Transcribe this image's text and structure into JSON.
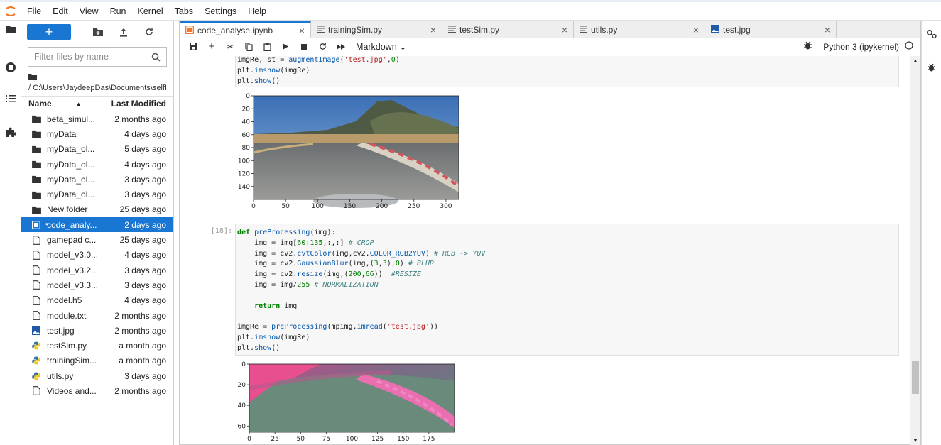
{
  "menu": [
    "File",
    "Edit",
    "View",
    "Run",
    "Kernel",
    "Tabs",
    "Settings",
    "Help"
  ],
  "filebrowser": {
    "filter_placeholder": "Filter files by name",
    "path": "/ C:\\Users\\JaydeepDas\\Documents\\selfI",
    "col_name": "Name",
    "col_modified": "Last Modified",
    "files": [
      {
        "name": "beta_simul...",
        "modified": "2 months ago",
        "type": "folder"
      },
      {
        "name": "myData",
        "modified": "4 days ago",
        "type": "folder"
      },
      {
        "name": "myData_ol...",
        "modified": "5 days ago",
        "type": "folder"
      },
      {
        "name": "myData_ol...",
        "modified": "4 days ago",
        "type": "folder"
      },
      {
        "name": "myData_ol...",
        "modified": "3 days ago",
        "type": "folder"
      },
      {
        "name": "myData_ol...",
        "modified": "3 days ago",
        "type": "folder"
      },
      {
        "name": "New folder",
        "modified": "25 days ago",
        "type": "folder"
      },
      {
        "name": "code_analy...",
        "modified": "2 days ago",
        "type": "notebook",
        "selected": true
      },
      {
        "name": "gamepad c...",
        "modified": "25 days ago",
        "type": "file"
      },
      {
        "name": "model_v3.0...",
        "modified": "4 days ago",
        "type": "file"
      },
      {
        "name": "model_v3.2...",
        "modified": "3 days ago",
        "type": "file"
      },
      {
        "name": "model_v3.3...",
        "modified": "3 days ago",
        "type": "file"
      },
      {
        "name": "model.h5",
        "modified": "4 days ago",
        "type": "file"
      },
      {
        "name": "module.txt",
        "modified": "2 months ago",
        "type": "file"
      },
      {
        "name": "test.jpg",
        "modified": "2 months ago",
        "type": "image"
      },
      {
        "name": "testSim.py",
        "modified": "a month ago",
        "type": "python"
      },
      {
        "name": "trainingSim...",
        "modified": "a month ago",
        "type": "python"
      },
      {
        "name": "utils.py",
        "modified": "3 days ago",
        "type": "python"
      },
      {
        "name": "Videos and...",
        "modified": "2 months ago",
        "type": "file"
      }
    ]
  },
  "tabs": [
    {
      "label": "code_analyse.ipynb",
      "icon": "notebook-icon",
      "active": true
    },
    {
      "label": "trainingSim.py",
      "icon": "text-file-icon"
    },
    {
      "label": "testSim.py",
      "icon": "text-file-icon"
    },
    {
      "label": "utils.py",
      "icon": "text-file-icon"
    },
    {
      "label": "test.jpg",
      "icon": "image-icon"
    }
  ],
  "toolbar": {
    "cell_type": "Markdown",
    "kernel": "Python 3 (ipykernel)"
  },
  "cell1": {
    "lines": [
      "imgRe, st = augmentImage('test.jpg',0)",
      "plt.imshow(imgRe)",
      "plt.show()"
    ]
  },
  "plot1": {
    "x_ticks": [
      "0",
      "50",
      "100",
      "150",
      "200",
      "250",
      "300"
    ],
    "y_ticks": [
      "0",
      "20",
      "40",
      "60",
      "80",
      "100",
      "120",
      "140"
    ]
  },
  "cell2": {
    "prompt": "[18]:",
    "lines": [
      "def preProcessing(img):",
      "    img = img[60:135,:,:] # CROP",
      "    img = cv2.cvtColor(img,cv2.COLOR_RGB2YUV) # RGB -> YUV",
      "    img = cv2.GaussianBlur(img,(3,3),0) # BLUR",
      "    img = cv2.resize(img,(200,66))  #RESIZE",
      "    img = img/255 # NORMALIZATION",
      "",
      "    return img",
      "",
      "imgRe = preProcessing(mpimg.imread('test.jpg'))",
      "plt.imshow(imgRe)",
      "plt.show()"
    ]
  },
  "plot2": {
    "x_ticks": [
      "0",
      "25",
      "50",
      "75",
      "100",
      "125",
      "150",
      "175"
    ],
    "y_ticks": [
      "0",
      "20",
      "40",
      "60"
    ]
  }
}
